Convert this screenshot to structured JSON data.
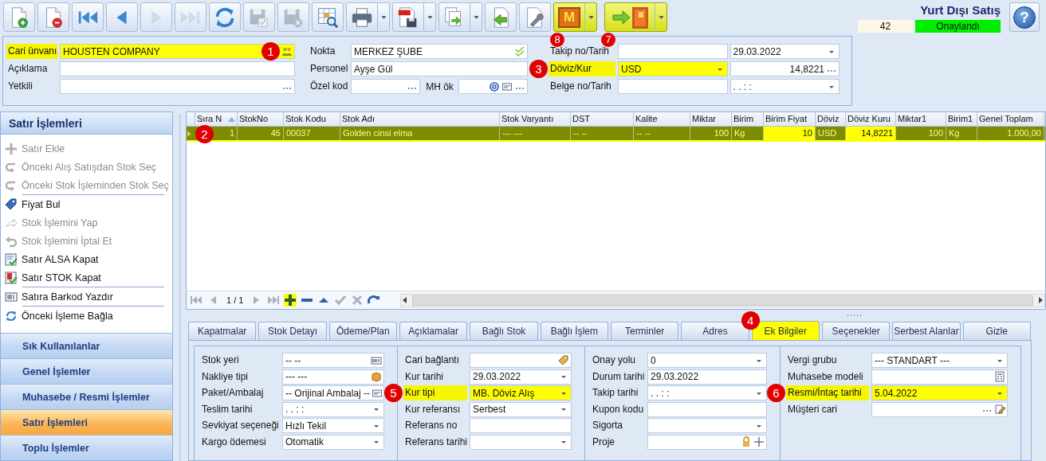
{
  "toolbar": [
    {
      "kind": "new",
      "disabled": false,
      "dropdown": false,
      "highlighted": false
    },
    {
      "kind": "delete",
      "disabled": false,
      "dropdown": false,
      "highlighted": false
    },
    {
      "kind": "first",
      "disabled": false,
      "dropdown": false,
      "highlighted": false
    },
    {
      "kind": "prev",
      "disabled": false,
      "dropdown": false,
      "highlighted": false
    },
    {
      "kind": "next",
      "disabled": true,
      "dropdown": false,
      "highlighted": false
    },
    {
      "kind": "last",
      "disabled": true,
      "dropdown": false,
      "highlighted": false
    },
    {
      "kind": "refresh",
      "disabled": false,
      "dropdown": false,
      "highlighted": false
    },
    {
      "kind": "save",
      "disabled": true,
      "dropdown": false,
      "highlighted": false
    },
    {
      "kind": "discard",
      "disabled": true,
      "dropdown": false,
      "highlighted": false
    },
    {
      "kind": "report",
      "disabled": false,
      "dropdown": false,
      "highlighted": false
    },
    {
      "kind": "print",
      "disabled": false,
      "dropdown": true,
      "highlighted": false
    },
    {
      "kind": "pdf",
      "disabled": false,
      "dropdown": true,
      "highlighted": false
    },
    {
      "kind": "export",
      "disabled": false,
      "dropdown": true,
      "highlighted": false
    },
    {
      "kind": "import",
      "disabled": false,
      "dropdown": false,
      "highlighted": false
    },
    {
      "kind": "tools",
      "disabled": false,
      "dropdown": false,
      "highlighted": false
    },
    {
      "kind": "letter",
      "label": "M",
      "disabled": false,
      "dropdown": true,
      "highlighted": true,
      "badge": "8"
    },
    {
      "kind": "exit",
      "disabled": false,
      "dropdown": true,
      "highlighted": true,
      "badge": "7"
    }
  ],
  "document": {
    "title": "Yurt Dışı Satış",
    "number": "42",
    "status": "Onaylandı"
  },
  "help": {
    "label": "?"
  },
  "header": {
    "columns": [
      {
        "fields": [
          {
            "label": "Cari ünvanı",
            "highlighted": true,
            "inputs": [
              {
                "kind": "lookup",
                "value": "HOUSTEN COMPANY",
                "highlighted": true,
                "badge": "1"
              }
            ]
          },
          {
            "label": "Açıklama",
            "highlighted": false,
            "inputs": [
              {
                "kind": "text",
                "highlighted": false
              }
            ]
          },
          {
            "label": "Yetkili",
            "highlighted": false,
            "inputs": [
              {
                "kind": "picker",
                "highlighted": false
              }
            ]
          }
        ]
      },
      {
        "fields": [
          {
            "label": "Nokta",
            "highlighted": false,
            "inputs": [
              {
                "kind": "verified",
                "value": "MERKEZ ŞUBE",
                "highlighted": false
              }
            ]
          },
          {
            "label": "Personel",
            "highlighted": false,
            "inputs": [
              {
                "kind": "text",
                "value": "Ayşe Gül",
                "highlighted": false
              }
            ]
          },
          {
            "label": "Özel kod",
            "highlighted": false,
            "inputs": [
              {
                "kind": "picker",
                "highlighted": false
              },
              {
                "kind": "email",
                "label": "MH ök",
                "highlighted": false
              }
            ]
          }
        ]
      },
      {
        "fields": [
          {
            "label": "Takip no/Tarih",
            "highlighted": false,
            "inputs": [
              {
                "kind": "text",
                "highlighted": false
              },
              {
                "kind": "combo",
                "value": "29.03.2022",
                "highlighted": false
              }
            ]
          },
          {
            "label": "Döviz/Kur",
            "highlighted": true,
            "badge": "3",
            "inputs": [
              {
                "kind": "combo",
                "value": "USD",
                "highlighted": true
              },
              {
                "kind": "rate",
                "value": "14,8221",
                "highlighted": false
              }
            ]
          },
          {
            "label": "Belge no/Tarih",
            "highlighted": false,
            "inputs": [
              {
                "kind": "text",
                "highlighted": false
              },
              {
                "kind": "combo",
                "value": ".  .      :  :",
                "highlighted": false
              }
            ]
          }
        ]
      }
    ]
  },
  "sidebar": {
    "title": "Satır İşlemleri",
    "items": [
      {
        "kind": "plus",
        "label": "Satır Ekle",
        "disabled": true
      },
      {
        "kind": "back",
        "label": "Önceki Alış Satışdan Stok Seç",
        "disabled": true
      },
      {
        "kind": "back",
        "label": "Önceki Stok İşleminden Stok Seç",
        "disabled": true
      },
      {
        "kind": "separator"
      },
      {
        "kind": "tag",
        "label": "Fiyat Bul",
        "disabled": false
      },
      {
        "kind": "forward",
        "label": "Stok İşlemini Yap",
        "disabled": true
      },
      {
        "kind": "undo",
        "label": "Stok İşlemini İptal Et",
        "disabled": true
      },
      {
        "kind": "doc-check",
        "label": "Satır ALSA Kapat",
        "disabled": false
      },
      {
        "kind": "flag-check",
        "label": "Satır STOK Kapat",
        "disabled": false
      },
      {
        "kind": "separator"
      },
      {
        "kind": "barcode",
        "label": "Satıra Barkod Yazdır",
        "disabled": false
      },
      {
        "kind": "separator"
      },
      {
        "kind": "link",
        "label": "Önceki İşleme Bağla",
        "disabled": false
      }
    ],
    "groups": [
      {
        "label": "Sık Kullanılanlar",
        "selected": false
      },
      {
        "label": "Genel İşlemler",
        "selected": false
      },
      {
        "label": "Muhasebe / Resmi İşlemler",
        "selected": false
      },
      {
        "label": "Satır İşlemleri",
        "selected": true
      },
      {
        "label": "Toplu İşlemler",
        "selected": false
      }
    ]
  },
  "table": {
    "columns": [
      {
        "label": "Sıra N",
        "sorted": true,
        "numeric": true,
        "highlighted": false
      },
      {
        "label": "StokNo",
        "sorted": false,
        "numeric": true,
        "highlighted": false
      },
      {
        "label": "Stok Kodu",
        "sorted": false,
        "numeric": false,
        "highlighted": false
      },
      {
        "label": "Stok Adı",
        "sorted": false,
        "numeric": false,
        "highlighted": false
      },
      {
        "label": "Stok Varyantı",
        "sorted": false,
        "numeric": false,
        "highlighted": false
      },
      {
        "label": "DST",
        "sorted": false,
        "numeric": false,
        "highlighted": false
      },
      {
        "label": "Kalite",
        "sorted": false,
        "numeric": false,
        "highlighted": false
      },
      {
        "label": "Miktar",
        "sorted": false,
        "numeric": true,
        "highlighted": false
      },
      {
        "label": "Birim",
        "sorted": false,
        "numeric": false,
        "highlighted": false
      },
      {
        "label": "Birim Fiyat",
        "sorted": false,
        "numeric": true,
        "highlighted": true
      },
      {
        "label": "Döviz",
        "sorted": false,
        "numeric": false,
        "highlighted": false
      },
      {
        "label": "Döviz Kuru",
        "sorted": false,
        "numeric": true,
        "highlighted": true
      },
      {
        "label": "Miktar1",
        "sorted": false,
        "numeric": true,
        "highlighted": false
      },
      {
        "label": "Birim1",
        "sorted": false,
        "numeric": false,
        "highlighted": false
      },
      {
        "label": "Genel Toplam",
        "sorted": false,
        "numeric": true,
        "highlighted": false
      }
    ],
    "rows": [
      {
        "selected": true,
        "badge": "2",
        "cells": [
          "1",
          "45",
          "00037",
          "Golden cinsi elma",
          "--- ---",
          "-- --",
          "-- --",
          "100",
          "Kg",
          "10",
          "USD",
          "14,8221",
          "100",
          "Kg",
          "1.000,00"
        ]
      }
    ],
    "pager": "1 / 1"
  },
  "tabs": [
    {
      "label": "Kapatmalar",
      "selected": false
    },
    {
      "label": "Stok Detayı",
      "selected": false
    },
    {
      "label": "Ödeme/Plan",
      "selected": false
    },
    {
      "label": "Açıklamalar",
      "selected": false
    },
    {
      "label": "Bağlı Stok",
      "selected": false
    },
    {
      "label": "Bağlı İşlem",
      "selected": false
    },
    {
      "label": "Terminler",
      "selected": false
    },
    {
      "label": "Adres",
      "selected": false
    },
    {
      "label": "Ek Bilgiler",
      "selected": true,
      "badge": "4"
    },
    {
      "label": "Seçenekler",
      "selected": false
    },
    {
      "label": "Serbest Alanlar",
      "selected": false
    },
    {
      "label": "Gizle",
      "selected": false
    }
  ],
  "details": {
    "groups": [
      {
        "fields": [
          {
            "label": "Stok yeri",
            "highlighted": false,
            "inputs": [
              {
                "kind": "barcode",
                "value": "-- --",
                "highlighted": false
              }
            ]
          },
          {
            "label": "Nakliye tipi",
            "highlighted": false,
            "inputs": [
              {
                "kind": "box",
                "value": "--- ---",
                "highlighted": false
              }
            ]
          },
          {
            "label": "Paket/Ambalaj",
            "highlighted": false,
            "inputs": [
              {
                "kind": "pack",
                "value": "-- Orijinal Ambalaj --",
                "highlighted": false
              }
            ]
          },
          {
            "label": "Teslim tarihi",
            "highlighted": false,
            "inputs": [
              {
                "kind": "combo",
                "value": ".  .      :  :",
                "highlighted": false
              }
            ]
          },
          {
            "label": "Sevkiyat seçeneği",
            "highlighted": false,
            "inputs": [
              {
                "kind": "combo",
                "value": "Hızlı Tekil",
                "highlighted": false
              }
            ]
          },
          {
            "label": "Kargo ödemesi",
            "highlighted": false,
            "inputs": [
              {
                "kind": "combo",
                "value": "Otomatik",
                "highlighted": false
              }
            ]
          }
        ]
      },
      {
        "fields": [
          {
            "label": "Cari bağlantı",
            "highlighted": false,
            "inputs": [
              {
                "kind": "link",
                "highlighted": false
              }
            ]
          },
          {
            "label": "Kur tarihi",
            "highlighted": false,
            "inputs": [
              {
                "kind": "combo",
                "value": "29.03.2022",
                "highlighted": false
              }
            ]
          },
          {
            "label": "Kur tipi",
            "highlighted": true,
            "badge": "5",
            "inputs": [
              {
                "kind": "combo",
                "value": "MB. Döviz Alış",
                "highlighted": true
              }
            ]
          },
          {
            "label": "Kur referansı",
            "highlighted": false,
            "inputs": [
              {
                "kind": "combo",
                "value": "Serbest",
                "highlighted": false
              }
            ]
          },
          {
            "label": "Referans no",
            "highlighted": false,
            "inputs": [
              {
                "kind": "text",
                "highlighted": false
              }
            ]
          },
          {
            "label": "Referans tarihi",
            "highlighted": false,
            "inputs": [
              {
                "kind": "combo",
                "highlighted": false
              }
            ]
          }
        ]
      },
      {
        "fields": [
          {
            "label": "Onay yolu",
            "highlighted": false,
            "inputs": [
              {
                "kind": "combo",
                "value": "0",
                "highlighted": false
              }
            ]
          },
          {
            "label": "Durum tarihi",
            "highlighted": false,
            "inputs": [
              {
                "kind": "text",
                "value": "29.03.2022",
                "highlighted": false
              }
            ]
          },
          {
            "label": "Takip tarihi",
            "highlighted": false,
            "inputs": [
              {
                "kind": "combo",
                "value": ".  .      :  :",
                "highlighted": false
              }
            ]
          },
          {
            "label": "Kupon kodu",
            "highlighted": false,
            "inputs": [
              {
                "kind": "text",
                "highlighted": false
              }
            ]
          },
          {
            "label": "Sigorta",
            "highlighted": false,
            "inputs": [
              {
                "kind": "combo",
                "highlighted": false
              }
            ]
          },
          {
            "label": "Proje",
            "highlighted": false,
            "inputs": [
              {
                "kind": "project",
                "highlighted": false
              }
            ]
          }
        ]
      },
      {
        "fields": [
          {
            "label": "Vergi grubu",
            "highlighted": false,
            "inputs": [
              {
                "kind": "combo",
                "value": "--- STANDART ---",
                "highlighted": false
              }
            ]
          },
          {
            "label": "Muhasebe modeli",
            "highlighted": false,
            "inputs": [
              {
                "kind": "calc",
                "highlighted": false
              }
            ]
          },
          {
            "label": "Resmi/İntaç tarihi",
            "highlighted": true,
            "badge": "6",
            "inputs": [
              {
                "kind": "combo",
                "value": "5.04.2022",
                "highlighted": true
              }
            ]
          },
          {
            "label": "Müşteri cari",
            "highlighted": false,
            "inputs": [
              {
                "kind": "customer",
                "highlighted": false
              }
            ]
          }
        ]
      }
    ]
  }
}
